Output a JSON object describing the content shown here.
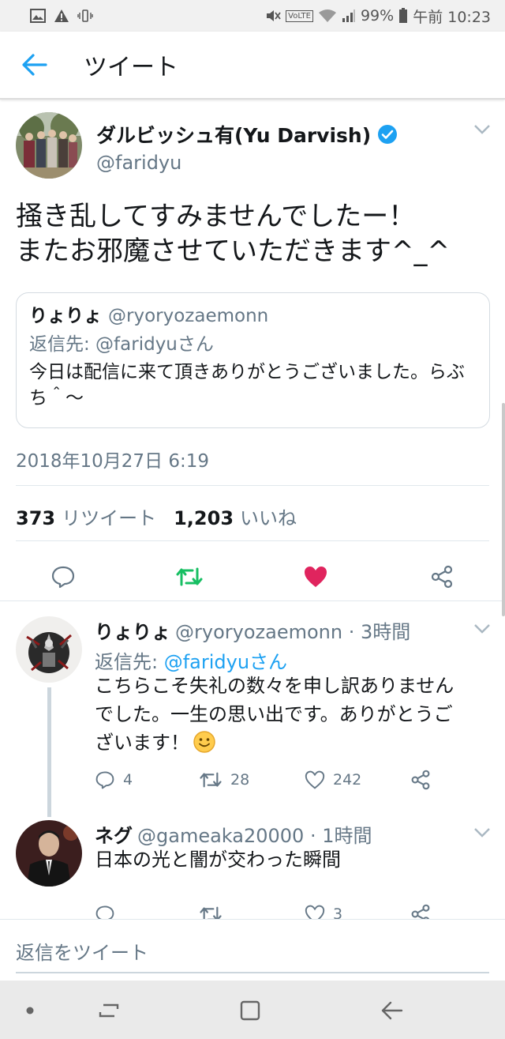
{
  "status_bar": {
    "battery": "99%",
    "time": "午前 10:23",
    "network": "VoLTE",
    "left_icons": [
      "image-icon",
      "warning-icon",
      "vibrate-icon"
    ]
  },
  "app_bar": {
    "title": "ツイート",
    "back_icon": "arrow-left-icon"
  },
  "tweet": {
    "author_name": "ダルビッシュ有(Yu Darvish)",
    "handle": "@faridyu",
    "text_lines": [
      "掻き乱してすみませんでしたー！",
      "またお邪魔させていただきます^_^"
    ],
    "quote": {
      "name": "りょりょ",
      "handle": "@ryoryozaemonn",
      "reply_to": "返信先: @faridyuさん",
      "body": "今日は配信に来て頂きありがとうございました。らぶち＾～"
    },
    "timestamp": "2018年10月27日 6:19",
    "retweets": "373",
    "retweets_label": "リツイート",
    "likes": "1,203",
    "likes_label": "いいね"
  },
  "replies": [
    {
      "name": "りょりょ",
      "handle_time": "@ryoryozaemonn · 3時間",
      "reply_prefix": "返信先: ",
      "reply_to": "@faridyuさん",
      "body_lines": [
        "こちらこそ失礼の数々を申し訳ありません",
        "でした。一生の思い出です。ありがとうご",
        "ざいます！"
      ],
      "replies": "4",
      "retweets": "28",
      "likes": "242"
    },
    {
      "name": "ネグ",
      "handle_time": "@gameaka20000 · 1時間",
      "body_lines": [
        "日本の光と闇が交わった瞬間"
      ],
      "replies": "",
      "retweets": "",
      "likes": "3"
    }
  ],
  "compose": {
    "placeholder": "返信をツイート"
  },
  "colors": {
    "accent": "#1da1f2",
    "retweet_green": "#17bf63",
    "like_red": "#e0245e",
    "secondary_text": "#657786"
  }
}
